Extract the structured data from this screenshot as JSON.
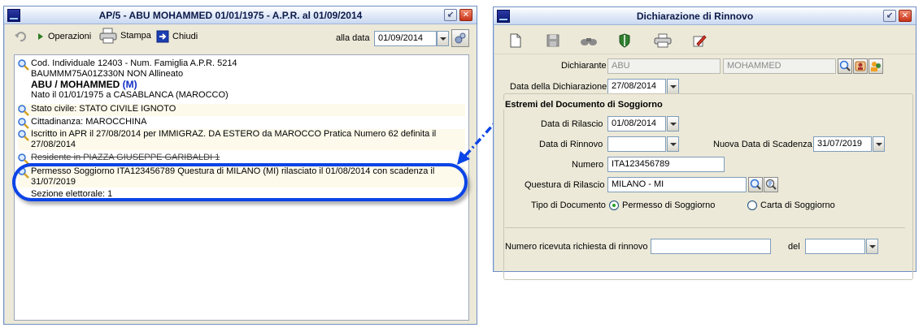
{
  "left_window": {
    "title": "AP/5 - ABU MOHAMMED 01/01/1975 - A.P.R. al 01/09/2014",
    "toolbar": {
      "operazioni": "Operazioni",
      "stampa": "Stampa",
      "chiudi": "Chiudi",
      "alla_data_label": "alla data",
      "alla_data_value": "01/09/2014"
    },
    "rows": {
      "r1_line1": "Cod. Individuale 12403 - Num. Famiglia A.P.R. 5214",
      "r1_line2": "BAUMMM75A01Z330N NON Allineato",
      "r1_name": "ABU / MOHAMMED",
      "r1_sex": "(M)",
      "r1_birth": "Nato il 01/01/1975 a CASABLANCA (MAROCCO)",
      "r2": "Stato civile: STATO CIVILE IGNOTO",
      "r3": "Cittadinanza: MAROCCHINA",
      "r4_line1": "Iscritto in APR il 27/08/2014 per IMMIGRAZ. DA ESTERO da MAROCCO Pratica Numero 62 definita il",
      "r4_line2": "27/08/2014",
      "r5": "Residente in PIAZZA GIUSEPPE GARIBALDI 1",
      "r6_line1": "Permesso Soggiorno ITA123456789 Questura di MILANO (MI) rilasciato il 01/08/2014 con scadenza il",
      "r6_line2": "31/07/2019",
      "r7": "Sezione elettorale: 1"
    }
  },
  "right_window": {
    "title": "Dichiarazione di Rinnovo",
    "dichiarante_label": "Dichiarante",
    "dichiarante_cognome": "ABU",
    "dichiarante_nome": "MOHAMMED",
    "data_dichiarazione_label": "Data della Dichiarazione",
    "data_dichiarazione_value": "27/08/2014",
    "group_title": "Estremi del Documento di Soggiorno",
    "data_rilascio_label": "Data di Rilascio",
    "data_rilascio_value": "01/08/2014",
    "data_rinnovo_label": "Data di Rinnovo",
    "data_rinnovo_value": "",
    "nuova_scadenza_label": "Nuova Data di Scadenza",
    "nuova_scadenza_value": "31/07/2019",
    "numero_label": "Numero",
    "numero_value": "ITA123456789",
    "questura_label": "Questura di Rilascio",
    "questura_value": "MILANO - MI",
    "tipo_label": "Tipo di Documento",
    "tipo_option1": "Permesso di Soggiorno",
    "tipo_option2": "Carta di Soggiorno",
    "ricevuta_label": "Numero ricevuta richiesta di rinnovo",
    "ricevuta_value": "",
    "del_label": "del",
    "del_value": ""
  },
  "colors": {
    "annotation_blue": "#0b44e6",
    "window_bg": "#ece9d8",
    "highlight_row": "#fdfaeb"
  }
}
